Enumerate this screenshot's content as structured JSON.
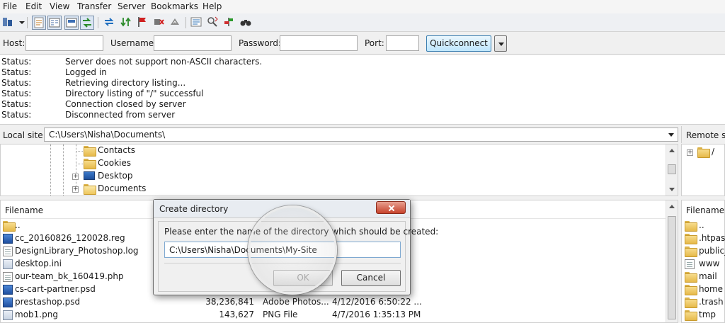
{
  "menu": [
    "File",
    "Edit",
    "View",
    "Transfer",
    "Server",
    "Bookmarks",
    "Help"
  ],
  "quickconnect": {
    "host_label": "Host:",
    "username_label": "Username:",
    "password_label": "Password:",
    "port_label": "Port:",
    "button_label": "Quickconnect",
    "host_value": "",
    "username_value": "",
    "password_value": "",
    "port_value": ""
  },
  "log": [
    {
      "kind": "Status:",
      "msg": "Server does not support non-ASCII characters."
    },
    {
      "kind": "Status:",
      "msg": "Logged in"
    },
    {
      "kind": "Status:",
      "msg": "Retrieving directory listing..."
    },
    {
      "kind": "Status:",
      "msg": "Directory listing of \"/\" successful"
    },
    {
      "kind": "Status:",
      "msg": "Connection closed by server"
    },
    {
      "kind": "Status:",
      "msg": "Disconnected from server"
    }
  ],
  "local": {
    "label": "Local site:",
    "path": "C:\\Users\\Nisha\\Documents\\",
    "tree": [
      "Contacts",
      "Cookies",
      "Desktop",
      "Documents"
    ]
  },
  "remote": {
    "label": "Remote site:",
    "tree_root": "/",
    "files_header": "Filename",
    "files": [
      "..",
      ".htpasswds",
      "public_ftp",
      "www",
      "mail",
      "home",
      ".trash",
      "tmp"
    ]
  },
  "file_list": {
    "header": "Filename",
    "rows": [
      {
        "name": "..",
        "size": "",
        "type": "",
        "date": ""
      },
      {
        "name": "cc_20160826_120028.reg",
        "size": "",
        "type": "",
        "date": ""
      },
      {
        "name": "DesignLibrary_Photoshop.log",
        "size": "",
        "type": "",
        "date": ""
      },
      {
        "name": "desktop.ini",
        "size": "",
        "type": "",
        "date": ""
      },
      {
        "name": "our-team_bk_160419.php",
        "size": "",
        "type": "",
        "date": ""
      },
      {
        "name": "cs-cart-partner.psd",
        "size": "",
        "type": "",
        "date": ""
      },
      {
        "name": "prestashop.psd",
        "size": "38,236,841",
        "type": "Adobe Photos...",
        "date": "4/12/2016 6:50:22 ..."
      },
      {
        "name": "mob1.png",
        "size": "143,627",
        "type": "PNG File",
        "date": "4/7/2016 1:35:13 PM"
      }
    ]
  },
  "dialog": {
    "title": "Create directory",
    "prompt": "Please enter the name of the directory which should be created:",
    "value": "C:\\Users\\Nisha\\Documents\\My-Site",
    "ok_label": "OK",
    "cancel_label": "Cancel"
  }
}
